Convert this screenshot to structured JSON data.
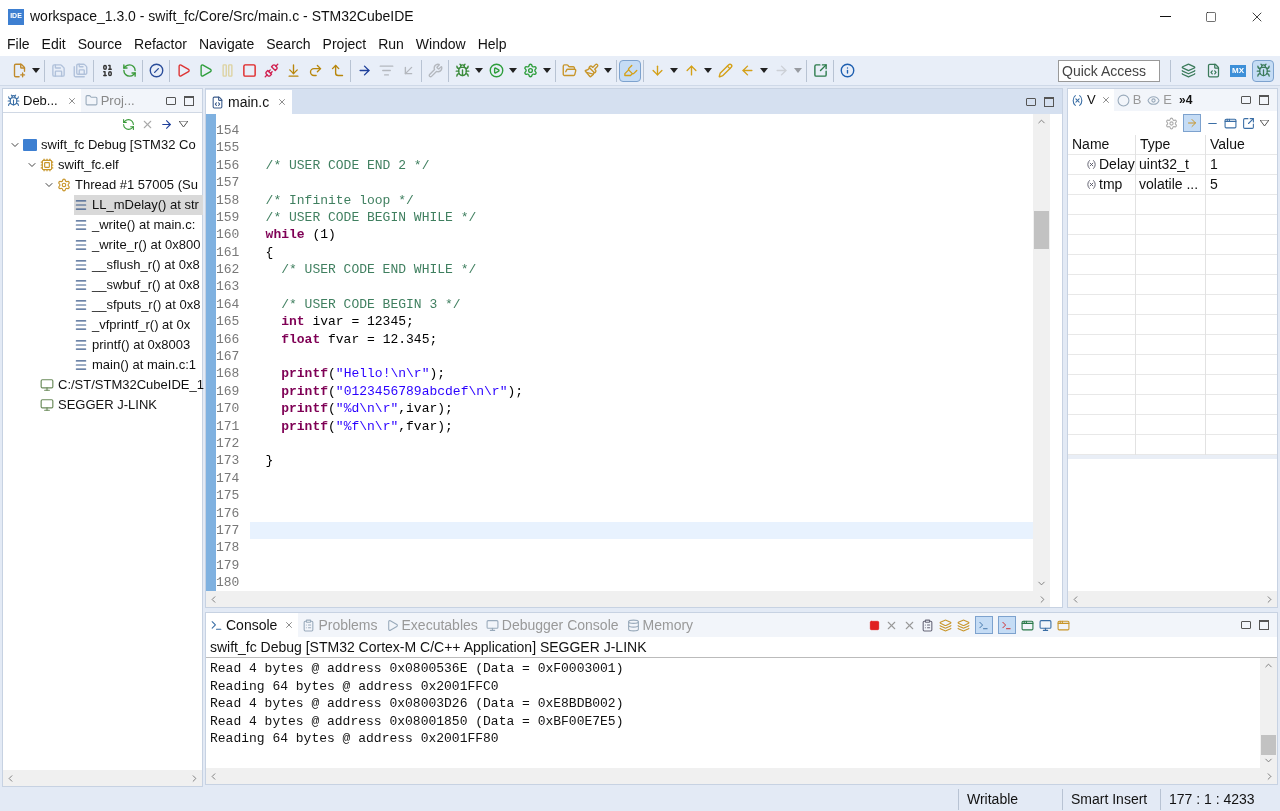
{
  "window": {
    "title": "workspace_1.3.0 - swift_fc/Core/Src/main.c - STM32CubeIDE",
    "app_icon": "IDE"
  },
  "menu": [
    "File",
    "Edit",
    "Source",
    "Refactor",
    "Navigate",
    "Search",
    "Project",
    "Run",
    "Window",
    "Help"
  ],
  "toolbar": [
    [
      {
        "kind": "new",
        "disabled": false,
        "on": false
      }
    ],
    [
      {
        "kind": "save",
        "disabled": true,
        "on": false
      },
      {
        "kind": "save_all",
        "disabled": true,
        "on": false
      }
    ],
    [
      {
        "kind": "binary",
        "disabled": false,
        "on": false
      },
      {
        "kind": "relaunch",
        "disabled": false,
        "on": false
      }
    ],
    [
      {
        "kind": "skip",
        "disabled": false,
        "on": false
      }
    ],
    [
      {
        "kind": "restart",
        "disabled": false,
        "on": false
      },
      {
        "kind": "resume",
        "disabled": false,
        "on": false
      },
      {
        "kind": "suspend",
        "disabled": true,
        "on": false
      },
      {
        "kind": "terminate",
        "disabled": false,
        "on": false
      },
      {
        "kind": "disconnect",
        "disabled": false,
        "on": false
      },
      {
        "kind": "step_into",
        "disabled": false,
        "on": false
      },
      {
        "kind": "step_over",
        "disabled": false,
        "on": false
      },
      {
        "kind": "step_return",
        "disabled": false,
        "on": false
      }
    ],
    [
      {
        "kind": "instruction",
        "disabled": false,
        "on": false
      },
      {
        "kind": "filters",
        "disabled": true,
        "on": false
      },
      {
        "kind": "drop_frame",
        "disabled": true,
        "on": false
      }
    ],
    [
      {
        "kind": "tools",
        "disabled": true,
        "on": false
      }
    ],
    [
      {
        "kind": "debug",
        "disabled": false,
        "on": false
      },
      {
        "kind": "run",
        "disabled": false,
        "on": false
      },
      {
        "kind": "run_ext",
        "disabled": false,
        "on": false
      }
    ],
    [
      {
        "kind": "open",
        "disabled": false,
        "on": false
      },
      {
        "kind": "brush",
        "disabled": false,
        "on": false
      }
    ],
    [
      {
        "kind": "highlight",
        "disabled": false,
        "on": true
      }
    ],
    [
      {
        "kind": "next",
        "disabled": false,
        "on": false
      },
      {
        "kind": "prev",
        "disabled": false,
        "on": false
      },
      {
        "kind": "last_edit",
        "disabled": false,
        "on": false
      },
      {
        "kind": "back",
        "disabled": false,
        "on": false
      },
      {
        "kind": "forward",
        "disabled": true,
        "on": false
      }
    ],
    [
      {
        "kind": "export",
        "disabled": false,
        "on": false
      }
    ],
    [
      {
        "kind": "info",
        "disabled": false,
        "on": false
      }
    ]
  ],
  "quick_access": {
    "placeholder": "Quick Access"
  },
  "perspectives": [
    {
      "kind": "open",
      "selected": false
    },
    {
      "kind": "cpp",
      "selected": false
    },
    {
      "kind": "mx",
      "label": "MX",
      "selected": false
    },
    {
      "kind": "debug",
      "selected": true
    }
  ],
  "debug_panel": {
    "tabs": [
      {
        "label": "Deb...",
        "kind": "debug",
        "selected": true
      },
      {
        "label": "Proj...",
        "kind": "project",
        "selected": false
      }
    ],
    "tree": [
      {
        "kind": "launch",
        "label": "swift_fc Debug [STM32 Co",
        "expanded": true,
        "selected": false,
        "children": [
          {
            "kind": "process",
            "label": "swift_fc.elf",
            "expanded": true,
            "selected": false,
            "children": [
              {
                "kind": "thread",
                "label": "Thread #1 57005 (Su",
                "expanded": true,
                "selected": false,
                "children": [
                  {
                    "kind": "frame",
                    "label": "LL_mDelay() at str",
                    "selected": true
                  },
                  {
                    "kind": "frame",
                    "label": "_write() at main.c:",
                    "selected": false
                  },
                  {
                    "kind": "frame",
                    "label": "_write_r() at 0x800",
                    "selected": false
                  },
                  {
                    "kind": "frame",
                    "label": "__sflush_r() at 0x8",
                    "selected": false
                  },
                  {
                    "kind": "frame",
                    "label": "__swbuf_r() at 0x8",
                    "selected": false
                  },
                  {
                    "kind": "frame",
                    "label": "__sfputs_r() at 0x8",
                    "selected": false
                  },
                  {
                    "kind": "frame",
                    "label": "_vfprintf_r() at 0x",
                    "selected": false
                  },
                  {
                    "kind": "frame",
                    "label": "printf() at 0x8003",
                    "selected": false
                  },
                  {
                    "kind": "frame",
                    "label": "main() at main.c:1",
                    "selected": false
                  }
                ]
              }
            ]
          },
          {
            "kind": "target",
            "label": "C:/ST/STM32CubeIDE_1",
            "selected": false
          },
          {
            "kind": "target",
            "label": "SEGGER J-LINK",
            "selected": false
          }
        ]
      }
    ]
  },
  "editor": {
    "tabs": [
      {
        "label": "main.c",
        "selected": true
      }
    ],
    "lines": [
      {
        "number": "154",
        "current": false
      },
      {
        "number": "155",
        "current": false
      },
      {
        "number": "156",
        "current": false,
        "segments": [
          {
            "kind": "comment",
            "text": "  /* USER CODE END 2 */"
          }
        ]
      },
      {
        "number": "157",
        "current": false
      },
      {
        "number": "158",
        "current": false,
        "segments": [
          {
            "kind": "comment",
            "text": "  /* Infinite loop */"
          }
        ]
      },
      {
        "number": "159",
        "current": false,
        "segments": [
          {
            "kind": "comment",
            "text": "  /* USER CODE BEGIN WHILE */"
          }
        ]
      },
      {
        "number": "160",
        "current": false,
        "segments": [
          {
            "kind": "keyword",
            "text": "  while"
          },
          {
            "kind": "plain",
            "text": " (1)"
          }
        ]
      },
      {
        "number": "161",
        "current": false,
        "segments": [
          {
            "kind": "plain",
            "text": "  {"
          }
        ]
      },
      {
        "number": "162",
        "current": false,
        "segments": [
          {
            "kind": "comment",
            "text": "    /* USER CODE END WHILE */"
          }
        ]
      },
      {
        "number": "163",
        "current": false
      },
      {
        "number": "164",
        "current": false,
        "segments": [
          {
            "kind": "comment",
            "text": "    /* USER CODE BEGIN 3 */"
          }
        ]
      },
      {
        "number": "165",
        "current": false,
        "segments": [
          {
            "kind": "keyword",
            "text": "    int"
          },
          {
            "kind": "plain",
            "text": " ivar = 12345;"
          }
        ]
      },
      {
        "number": "166",
        "current": false,
        "segments": [
          {
            "kind": "keyword",
            "text": "    float"
          },
          {
            "kind": "plain",
            "text": " fvar = 12.345;"
          }
        ]
      },
      {
        "number": "167",
        "current": false
      },
      {
        "number": "168",
        "current": false,
        "segments": [
          {
            "kind": "function",
            "text": "    printf"
          },
          {
            "kind": "plain",
            "text": "("
          },
          {
            "kind": "string",
            "text": "\"Hello!\\n\\r\""
          },
          {
            "kind": "plain",
            "text": ");"
          }
        ]
      },
      {
        "number": "169",
        "current": false,
        "segments": [
          {
            "kind": "function",
            "text": "    printf"
          },
          {
            "kind": "plain",
            "text": "("
          },
          {
            "kind": "string",
            "text": "\"0123456789abcdef\\n\\r\""
          },
          {
            "kind": "plain",
            "text": ");"
          }
        ]
      },
      {
        "number": "170",
        "current": false,
        "segments": [
          {
            "kind": "function",
            "text": "    printf"
          },
          {
            "kind": "plain",
            "text": "("
          },
          {
            "kind": "string",
            "text": "\"%d\\n\\r\""
          },
          {
            "kind": "plain",
            "text": ",ivar);"
          }
        ]
      },
      {
        "number": "171",
        "current": false,
        "segments": [
          {
            "kind": "function",
            "text": "    printf"
          },
          {
            "kind": "plain",
            "text": "("
          },
          {
            "kind": "string",
            "text": "\"%f\\n\\r\""
          },
          {
            "kind": "plain",
            "text": ",fvar);"
          }
        ]
      },
      {
        "number": "172",
        "current": false
      },
      {
        "number": "173",
        "current": false,
        "segments": [
          {
            "kind": "plain",
            "text": "  }"
          }
        ]
      },
      {
        "number": "174",
        "current": false
      },
      {
        "number": "175",
        "current": false
      },
      {
        "number": "176",
        "current": false
      },
      {
        "number": "177",
        "current": true
      },
      {
        "number": "178",
        "current": false
      },
      {
        "number": "179",
        "current": false
      },
      {
        "number": "180",
        "current": false
      }
    ]
  },
  "variables_panel": {
    "tabs": [
      {
        "label": "V",
        "kind": "variables",
        "selected": true
      },
      {
        "label": "B",
        "kind": "breakpoints",
        "selected": false
      },
      {
        "label": "E",
        "kind": "expressions",
        "selected": false
      }
    ],
    "overflow": "»4",
    "columns": [
      "Name",
      "Type",
      "Value"
    ],
    "rows": [
      {
        "name": "Delay",
        "type": "uint32_t",
        "value": "1"
      },
      {
        "name": "tmp",
        "type": "volatile ...",
        "value": "5"
      }
    ]
  },
  "console": {
    "tabs": [
      {
        "label": "Console",
        "kind": "console",
        "selected": true
      },
      {
        "label": "Problems",
        "kind": "problems",
        "selected": false
      },
      {
        "label": "Executables",
        "kind": "executables",
        "selected": false
      },
      {
        "label": "Debugger Console",
        "kind": "debugger",
        "selected": false
      },
      {
        "label": "Memory",
        "kind": "memory",
        "selected": false
      }
    ],
    "header": "swift_fc Debug [STM32 Cortex-M C/C++ Application] SEGGER J-LINK",
    "lines": [
      "Read 4 bytes @ address 0x0800536E (Data = 0xF0003001)",
      "Reading 64 bytes @ address 0x2001FFC0",
      "Read 4 bytes @ address 0x08003D26 (Data = 0xE8BDB002)",
      "Read 4 bytes @ address 0x08001850 (Data = 0xBF00E7E5)",
      "Reading 64 bytes @ address 0x2001FF80"
    ]
  },
  "status_bar": [
    "Writable",
    "Smart Insert",
    "177 : 1 : 4233"
  ]
}
